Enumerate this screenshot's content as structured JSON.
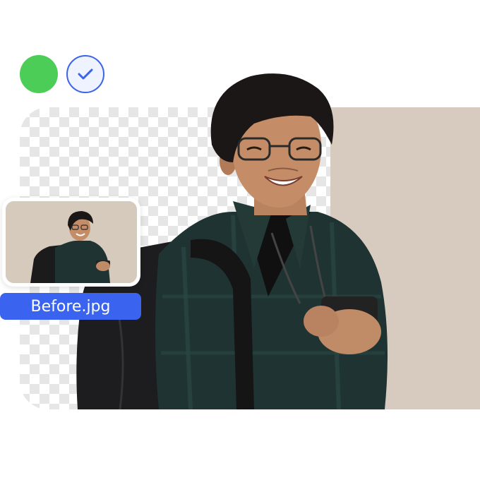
{
  "colors": {
    "green_swatch": "#4ccd57",
    "check_ring": "#3a64ea",
    "badge_bg": "#3a64f0",
    "wall": "#d7cbbf"
  },
  "icons": {
    "checkmark": "check-icon"
  },
  "before_label": "Before.jpg"
}
